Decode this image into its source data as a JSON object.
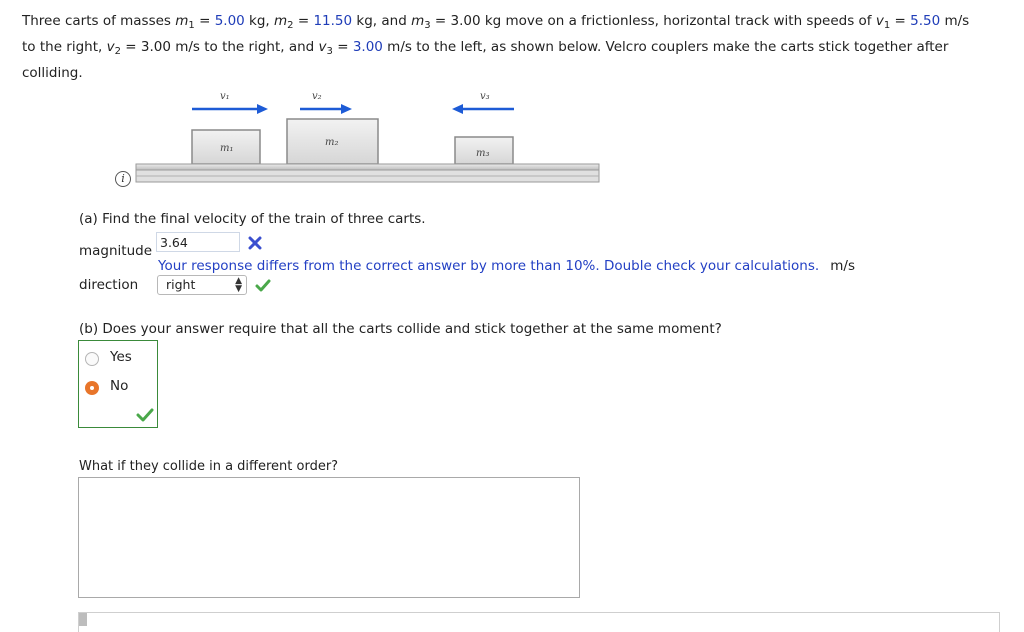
{
  "problem": {
    "p1": "Three carts of masses ",
    "m1_sym": "m",
    "m1_sub": "1",
    "eq1": " = ",
    "m1_val": "5.00",
    "kg_m2": " kg, ",
    "m2_sym": "m",
    "m2_sub": "2",
    "eq2": " = ",
    "m2_val": "11.50",
    "kg_and": " kg, and ",
    "m3_sym": "m",
    "m3_sub": "3",
    "m3_rest": " = 3.00 kg move on a frictionless, horizontal track with speeds of ",
    "v1_sym": "v",
    "v1_sub": "1",
    "eq_v1": " = ",
    "v1_val": "5.50",
    "v1_unit": " m/s",
    "line2_a": "to the right, ",
    "v2_sym": "v",
    "v2_sub": "2",
    "v2_rest": " = 3.00 m/s to the right, and ",
    "v3_sym": "v",
    "v3_sub": "3",
    "eq_v3": " = ",
    "v3_val": "3.00",
    "v3_rest": " m/s to the left, as shown below. Velcro couplers make the carts stick together after",
    "line3": "colliding."
  },
  "figure": {
    "v1": "v₁",
    "v2": "v₂",
    "v3": "v₃",
    "m1": "m₁",
    "m2": "m₂",
    "m3": "m₃",
    "info_icon": "i"
  },
  "part_a": {
    "question": "(a) Find the final velocity of the train of three carts.",
    "magnitude_label": "magnitude",
    "magnitude_value": "3.64",
    "feedback": "Your response differs from the correct answer by more than 10%. Double check your calculations.",
    "unit": "m/s",
    "direction_label": "direction",
    "direction_value": "right",
    "status_magnitude": "incorrect-x-icon",
    "status_direction": "correct-check-icon"
  },
  "part_b": {
    "question": "(b) Does your answer require that all the carts collide and stick together at the same moment?",
    "options": [
      {
        "label": "Yes",
        "selected": false
      },
      {
        "label": "No",
        "selected": true
      }
    ],
    "status": "correct-check-icon"
  },
  "followup": {
    "prompt": "What if they collide in a different order?",
    "answer": ""
  },
  "colors": {
    "given_value_blue": "#1f3db8",
    "feedback_blue": "#2340c4",
    "arrow_blue": "#1d5bd6",
    "correct_green": "#4aa84a",
    "incorrect_blue_x": "#3b4fcf",
    "selected_radio_orange": "#e8752a"
  }
}
